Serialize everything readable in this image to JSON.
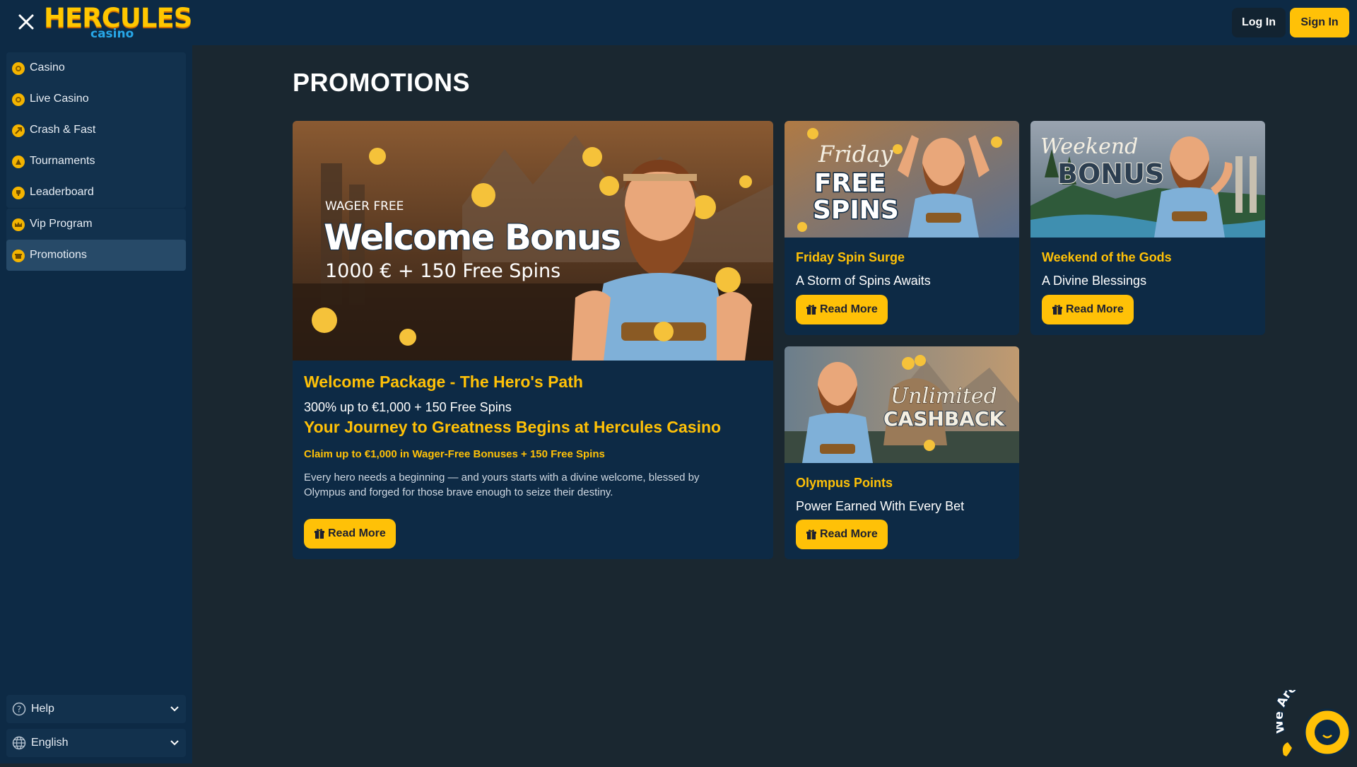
{
  "header": {
    "logo_main": "HERCULES",
    "logo_sub": "casino",
    "login_label": "Log In",
    "signin_label": "Sign In"
  },
  "sidebar": {
    "group1": [
      {
        "label": "Casino",
        "icon": "casino-chip-icon"
      },
      {
        "label": "Live Casino",
        "icon": "live-casino-icon"
      },
      {
        "label": "Crash & Fast",
        "icon": "crash-rocket-icon"
      },
      {
        "label": "Tournaments",
        "icon": "tournament-trophy-icon"
      },
      {
        "label": "Leaderboard",
        "icon": "leaderboard-trophy-icon"
      }
    ],
    "group2": [
      {
        "label": "Vip Program",
        "icon": "vip-crown-icon"
      },
      {
        "label": "Promotions",
        "icon": "promotions-gift-icon",
        "active": true
      }
    ],
    "help_label": "Help",
    "language_label": "English"
  },
  "main": {
    "page_title": "PROMOTIONS",
    "featured": {
      "banner_wager": "WAGER FREE",
      "banner_title": "Welcome Bonus",
      "banner_offer": "1000 € + 150 Free Spins",
      "title": "Welcome Package - The Hero's Path",
      "offer": "300% up to €1,000 + 150 Free Spins",
      "headline": "Your Journey to Greatness Begins at Hercules Casino",
      "claim": "Claim up to €1,000 in Wager-Free Bonuses + 150 Free Spins",
      "description_line1": "Every hero needs a beginning — and yours starts with a divine welcome, blessed by",
      "description_line2": "Olympus and forged for those brave enough to seize their destiny.",
      "button_label": "Read More"
    },
    "cards": [
      {
        "banner_line1": "Friday",
        "banner_line2": "FREE",
        "banner_line3": "SPINS",
        "title": "Friday Spin Surge",
        "subtitle": "A Storm of Spins Awaits",
        "button_label": "Read More"
      },
      {
        "banner_line1": "Weekend",
        "banner_line2": "BONUS",
        "title": "Weekend of the Gods",
        "subtitle": "A Divine Blessings",
        "button_label": "Read More"
      },
      {
        "banner_line1": "Unlimited",
        "banner_line2": "CASHBACK",
        "title": "Olympus Points",
        "subtitle": "Power Earned With Every Bet",
        "button_label": "Read More"
      }
    ]
  },
  "chat": {
    "label": "We Are Here"
  },
  "colors": {
    "accent": "#ffc107",
    "panel": "#0d2a45",
    "background": "#1a2730",
    "logo_sub": "#27a7e8"
  }
}
